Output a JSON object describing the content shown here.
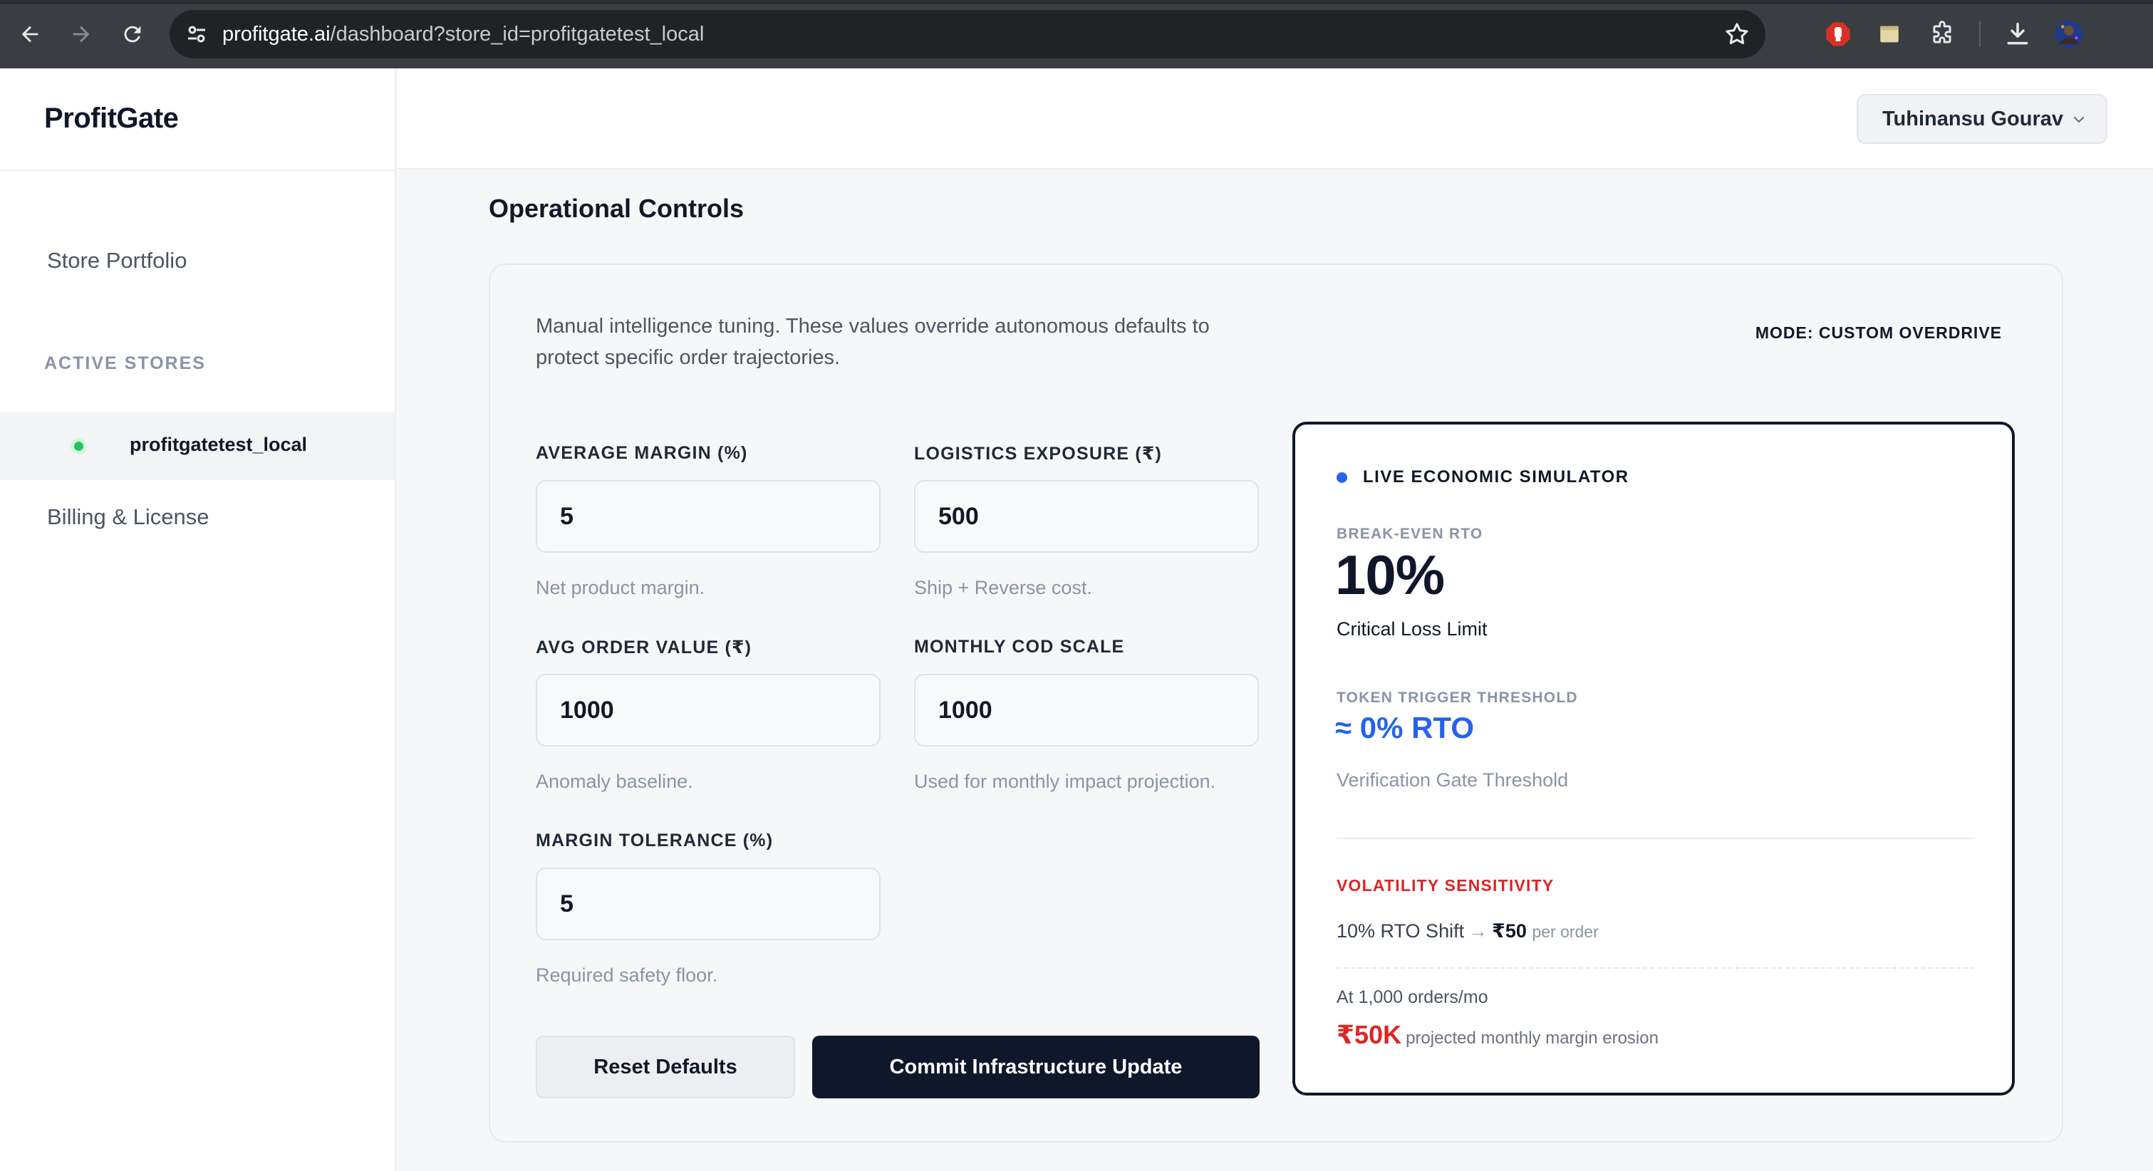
{
  "browser": {
    "url_host": "profitgate.ai",
    "url_path": "/dashboard?store_id=profitgatetest_local",
    "icons": [
      "back-arrow-icon",
      "forward-arrow-icon",
      "reload-icon",
      "site-settings-icon",
      "bookmark-star-icon",
      "extension-stop-icon",
      "extension-note-icon",
      "extensions-puzzle-icon",
      "download-icon",
      "profile-avatar-icon"
    ]
  },
  "sidebar": {
    "brand": "ProfitGate",
    "store_portfolio": "Store Portfolio",
    "active_stores_label": "ACTIVE STORES",
    "active_store": "profitgatetest_local",
    "billing": "Billing & License"
  },
  "header": {
    "user_name": "Tuhinansu Gourav"
  },
  "main": {
    "title": "Operational Controls",
    "description": "Manual intelligence tuning. These values override autonomous defaults to protect specific order trajectories.",
    "mode": "MODE: CUSTOM OVERDRIVE",
    "fields": {
      "avg_margin": {
        "label": "AVERAGE MARGIN (%)",
        "value": "5",
        "help": "Net product margin."
      },
      "logistics": {
        "label": "LOGISTICS EXPOSURE (₹)",
        "value": "500",
        "help": "Ship + Reverse cost."
      },
      "aov": {
        "label": "AVG ORDER VALUE (₹)",
        "value": "1000",
        "help": "Anomaly baseline."
      },
      "cod_scale": {
        "label": "MONTHLY COD SCALE",
        "value": "1000",
        "help": "Used for monthly impact projection."
      },
      "tolerance": {
        "label": "MARGIN TOLERANCE (%)",
        "value": "5",
        "help": "Required safety floor."
      }
    },
    "buttons": {
      "reset": "Reset Defaults",
      "commit": "Commit Infrastructure Update"
    }
  },
  "simulator": {
    "title": "LIVE ECONOMIC SIMULATOR",
    "breakeven_label": "BREAK-EVEN RTO",
    "breakeven_value": "10%",
    "breakeven_caption": "Critical Loss Limit",
    "token_label": "TOKEN TRIGGER THRESHOLD",
    "token_value": "≈ 0% RTO",
    "token_caption": "Verification Gate Threshold",
    "volatility_label": "VOLATILITY SENSITIVITY",
    "shift_text": "10% RTO Shift",
    "shift_arrow": "→",
    "shift_amount": "₹50",
    "shift_unit": "per order",
    "orders_text": "At 1,000 orders/mo",
    "erosion_value": "₹50K",
    "erosion_text": "projected monthly margin erosion"
  },
  "colors": {
    "accent_blue": "#2563eb",
    "danger_red": "#dc2626",
    "dark_navy": "#0f172a",
    "status_green": "#22c55e"
  }
}
